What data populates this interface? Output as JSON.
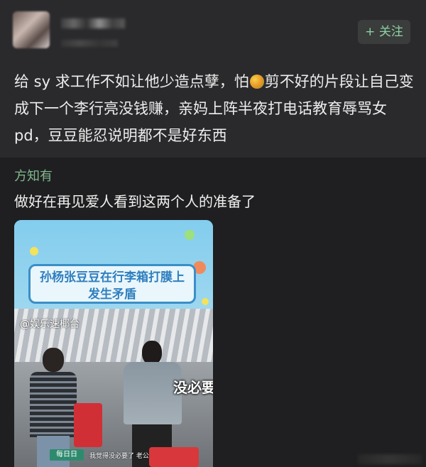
{
  "post": {
    "follow_label": "+ 关注",
    "text_part1": "给 sy 求工作不如让他少造点孽，怕",
    "text_part2": "剪不好的片段让自己变成下一个李行亮没钱赚，亲妈上阵半夜打电话教育辱骂女 pd，豆豆能忍说明都不是好东西",
    "emoji_icon": "mango-icon"
  },
  "comment": {
    "author": "方知有",
    "text": "做好在再见爱人看到这两个人的准备了"
  },
  "video": {
    "banner_line1": "孙杨张豆豆在行李箱打膜上",
    "banner_line2": "发生矛盾",
    "watermark": "@娱乐速椰台",
    "subtitle_big": "没必要",
    "tag": "每日日",
    "caption": "我觉得没必要了 老公"
  },
  "colors": {
    "background": "#1f1f21",
    "post_bg": "#2a2a2d",
    "accent_green": "#7fb88e",
    "banner_blue": "#2f7fbf"
  }
}
